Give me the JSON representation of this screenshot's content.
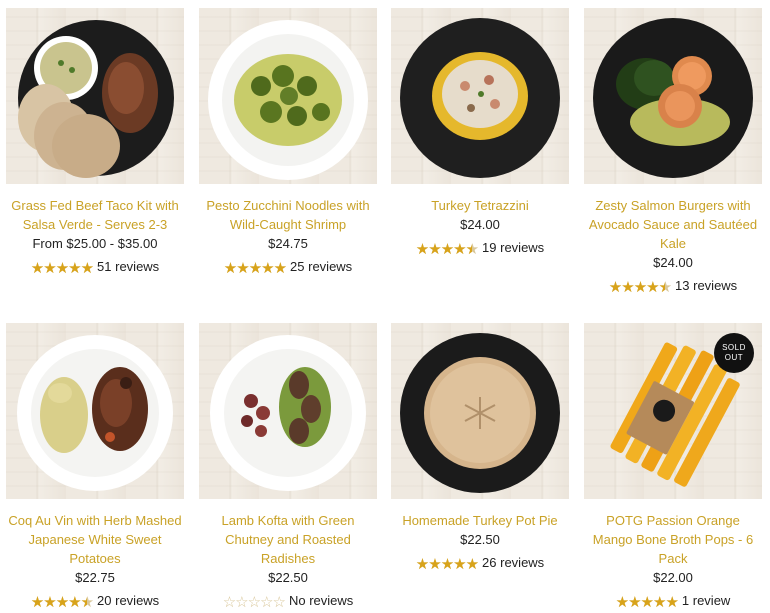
{
  "products": [
    {
      "title": "Grass Fed Beef Taco Kit with Salsa Verde - Serves 2-3",
      "price": "From $25.00 - $35.00",
      "rating": 1.0,
      "reviews": "51 reviews"
    },
    {
      "title": "Pesto Zucchini Noodles with Wild-Caught Shrimp",
      "price": "$24.75",
      "rating": 1.0,
      "reviews": "25 reviews"
    },
    {
      "title": "Turkey Tetrazzini",
      "price": "$24.00",
      "rating": 0.9,
      "reviews": "19 reviews"
    },
    {
      "title": "Zesty Salmon Burgers with Avocado Sauce and Sautéed Kale",
      "price": "$24.00",
      "rating": 0.9,
      "reviews": "13 reviews"
    },
    {
      "title": "Coq Au Vin with Herb Mashed Japanese White Sweet Potatoes",
      "price": "$22.75",
      "rating": 0.9,
      "reviews": "20 reviews"
    },
    {
      "title": "Lamb Kofta with Green Chutney and Roasted Radishes",
      "price": "$22.50",
      "rating": 0.0,
      "reviews": "No reviews"
    },
    {
      "title": "Homemade Turkey Pot Pie",
      "price": "$22.50",
      "rating": 1.0,
      "reviews": "26 reviews"
    },
    {
      "title": "POTG Passion Orange Mango Bone Broth Pops - 6 Pack",
      "price": "$22.00",
      "rating": 1.0,
      "reviews": "1 review",
      "badge": "SOLD OUT"
    }
  ],
  "icons": {
    "star": "star-icon"
  },
  "colors": {
    "accent": "#c9a227",
    "star": "#d8a31a"
  }
}
